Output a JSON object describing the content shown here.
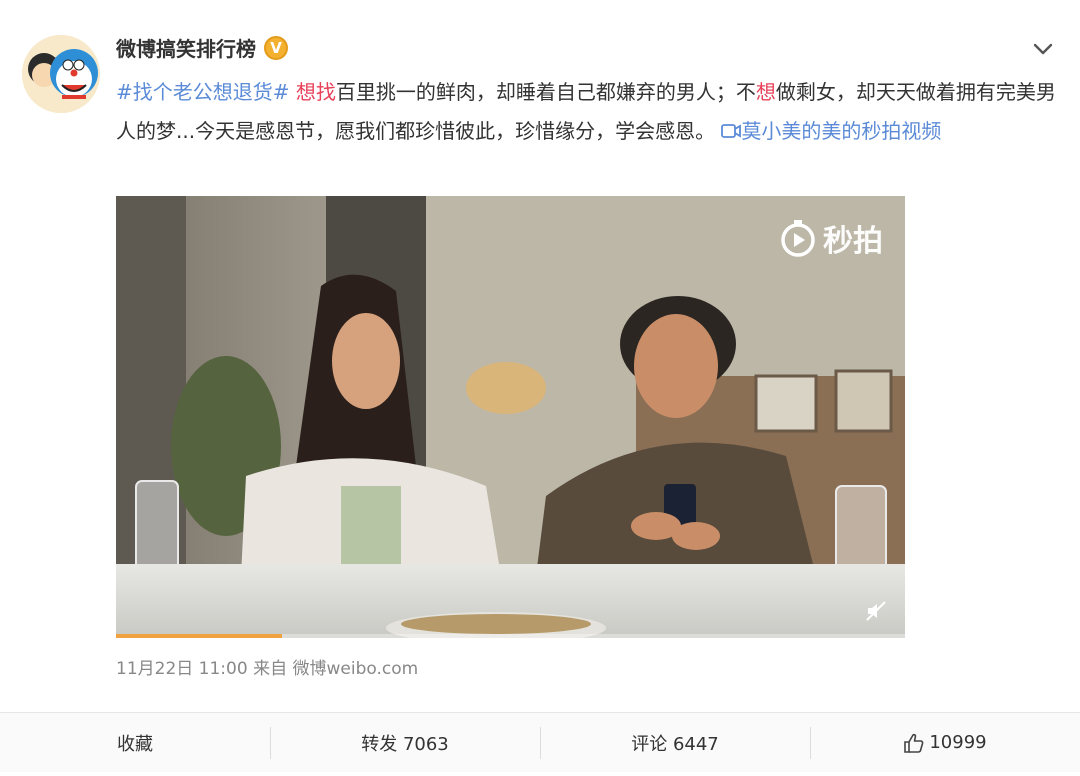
{
  "post": {
    "username": "微博搞笑排行榜",
    "verified_mark": "V",
    "hashtag": "#找个老公想退货#",
    "highlight_1": "想找",
    "text_1": "百里挑一的鲜肉，却睡着自己都嫌弃的男人；不",
    "highlight_2": "想",
    "text_2": "做剩女，却天天做着拥有完美男人的梦...今天是感恩节，愿我们都珍惜彼此，珍惜缘分，学会感恩。",
    "video_link_icon": "video-link-icon",
    "video_link": "莫小美的美的秒拍视频",
    "timestamp": "11月22日 11:00",
    "source_prefix": "来自",
    "source": "微博weibo.com"
  },
  "video": {
    "watermark": "秒拍",
    "progress": 0.21,
    "accent_color": "#f0a140"
  },
  "actions": {
    "favorite": "收藏",
    "repost": "转发 7063",
    "comment": "评论 6447",
    "like": "10999"
  },
  "colors": {
    "link": "#5b8bd7",
    "highlight": "#e8415a",
    "verified": "#f3b12f"
  }
}
